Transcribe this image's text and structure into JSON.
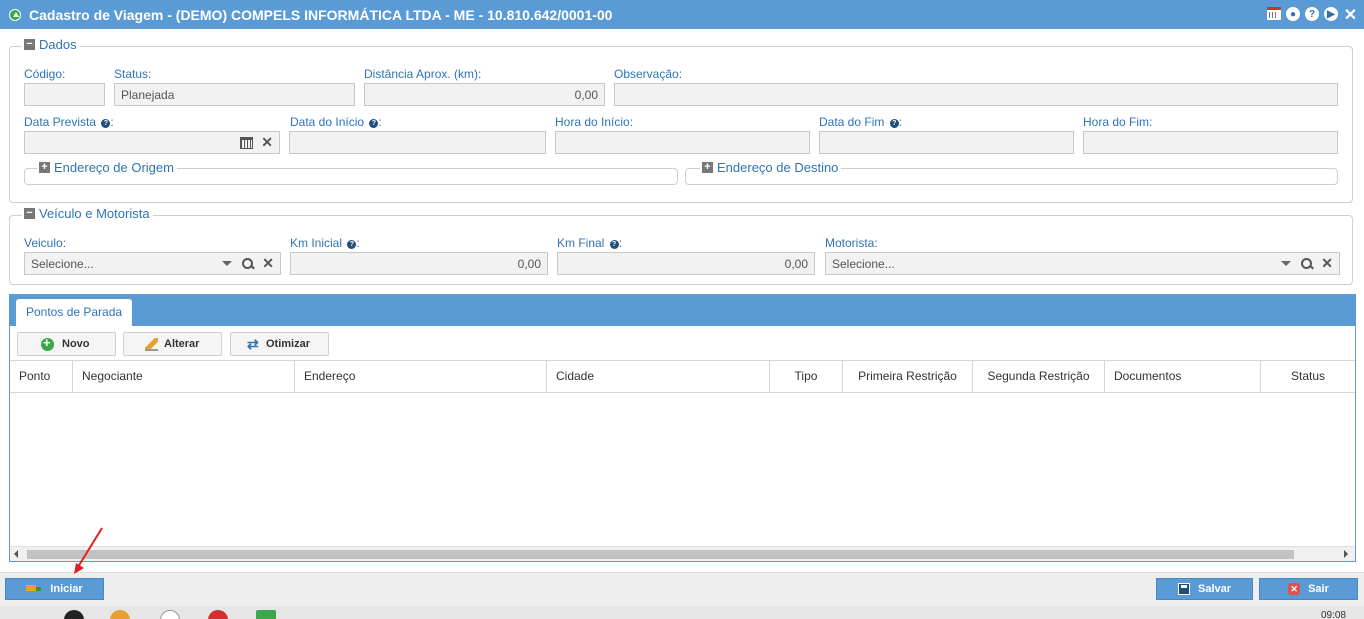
{
  "window": {
    "title": "Cadastro de Viagem - (DEMO) COMPELS INFORMÁTICA LTDA - ME - 10.810.642/0001-00",
    "controls": [
      "calendar-icon",
      "settings-icon",
      "help-icon",
      "play-icon",
      "close-icon"
    ]
  },
  "dados": {
    "legend": "Dados",
    "codigo_label": "Código:",
    "codigo_value": "",
    "status_label": "Status:",
    "status_value": "Planejada",
    "distancia_label": "Distância Aprox. (km):",
    "distancia_value": "0,00",
    "observacao_label": "Observação:",
    "observacao_value": "",
    "data_prevista_label": "Data Prevista",
    "data_prevista_value": "",
    "data_inicio_label": "Data do Início",
    "data_inicio_value": "",
    "hora_inicio_label": "Hora do Início:",
    "hora_inicio_value": "",
    "data_fim_label": "Data do Fim",
    "data_fim_value": "",
    "hora_fim_label": "Hora do Fim:",
    "hora_fim_value": "",
    "colon": ":",
    "help_glyph": "?",
    "endereco_origem": "Endereço de Origem",
    "endereco_destino": "Endereço de Destino"
  },
  "veiculo_motorista": {
    "legend": "Veículo e Motorista",
    "veiculo_label": "Veiculo:",
    "veiculo_value": "Selecione...",
    "km_inicial_label": "Km Inicial",
    "km_inicial_value": "0,00",
    "km_final_label": "Km Final",
    "km_final_value": "0,00",
    "motorista_label": "Motorista:",
    "motorista_value": "Selecione..."
  },
  "pontos_parada": {
    "tab_label": "Pontos de Parada",
    "buttons": {
      "novo": "Novo",
      "alterar": "Alterar",
      "otimizar": "Otimizar"
    },
    "columns": [
      "Ponto",
      "Negociante",
      "Endereço",
      "Cidade",
      "Tipo",
      "Primeira Restrição",
      "Segunda Restrição",
      "Documentos",
      "Status"
    ],
    "rows": []
  },
  "footer": {
    "iniciar": "Iniciar",
    "salvar": "Salvar",
    "sair": "Sair"
  },
  "taskbar": {
    "clock": "09:08"
  },
  "colors": {
    "accent": "#5b9bd5",
    "label": "#2f74b5",
    "annotation_arrow": "#e02020"
  }
}
